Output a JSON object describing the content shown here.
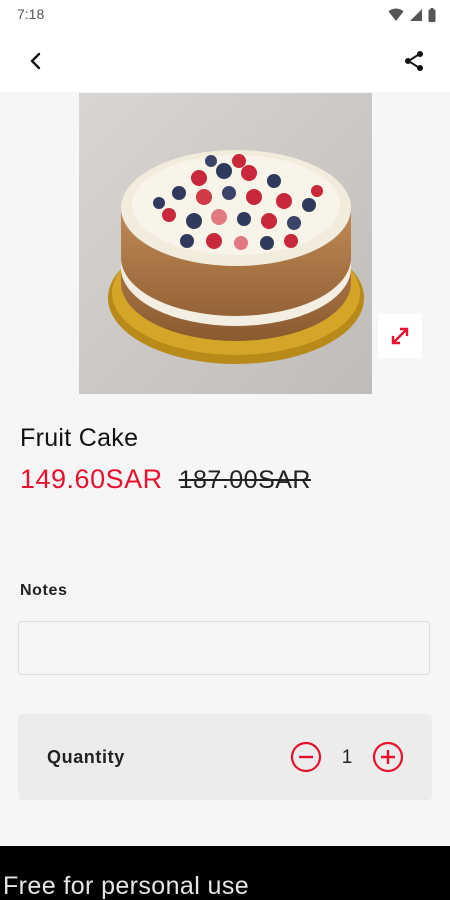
{
  "status_bar": {
    "time": "7:18"
  },
  "app_bar": {
    "back_icon": "back-arrow-icon",
    "share_icon": "share-icon"
  },
  "product": {
    "image_icon": "fruit-cake-photo",
    "name": "Fruit Cake",
    "price_current": "149.60SAR",
    "price_old": "187.00SAR",
    "accent_color": "#e8112d"
  },
  "notes": {
    "label": "Notes",
    "value": "",
    "placeholder": ""
  },
  "quantity": {
    "label": "Quantity",
    "value": "1",
    "minus_icon": "minus-circle-icon",
    "plus_icon": "plus-circle-icon"
  },
  "footer": {
    "text": "Free for personal use"
  }
}
